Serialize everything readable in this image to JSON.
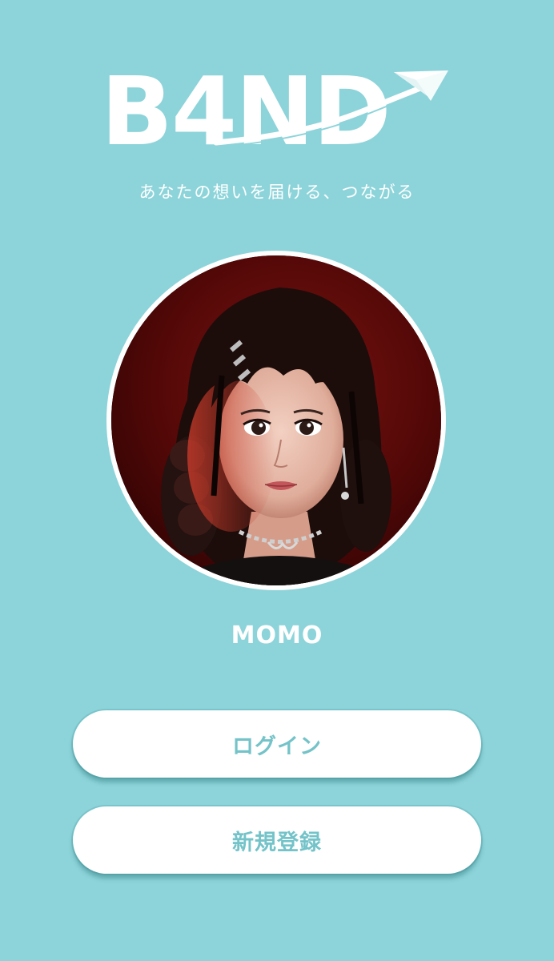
{
  "brand": {
    "logo_text": "B4ND",
    "tagline": "あなたの想いを届ける、つながる",
    "color_primary": "#8dd4da",
    "color_white": "#ffffff",
    "color_button_text": "#73c3c9"
  },
  "profile": {
    "name": "MOMO"
  },
  "actions": {
    "login_label": "ログイン",
    "register_label": "新規登録"
  }
}
